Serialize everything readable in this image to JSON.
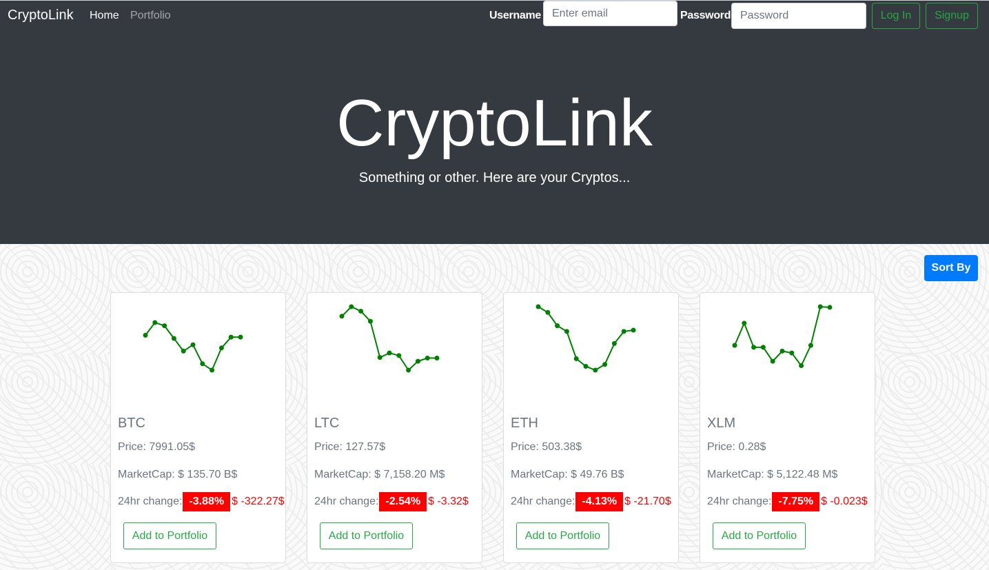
{
  "nav": {
    "brand": "CryptoLink",
    "links": [
      "Home",
      "Portfolio"
    ],
    "username_label": "Username",
    "email_placeholder": "Enter email",
    "password_label": "Password",
    "password_placeholder": "Password",
    "login_label": "Log In",
    "signup_label": "Signup"
  },
  "hero": {
    "title": "CryptoLink",
    "subtitle": "Something or other. Here are your Cryptos..."
  },
  "toolbar": {
    "sort_label": "Sort By"
  },
  "colors": {
    "dark": "#343a40",
    "success": "#28a745",
    "primary": "#007bff",
    "negative": "#ff0000",
    "spark": "#008000"
  },
  "cards": [
    {
      "symbol": "BTC",
      "price": "Price: 7991.05$",
      "market_cap": "MarketCap: $ 135.70 B$",
      "change_label": "24hr change:",
      "change_pct": "-3.88%",
      "change_abs": "$ -322.27$",
      "add_label": "Add to Portfolio",
      "spark": [
        0.55,
        0.75,
        0.7,
        0.5,
        0.3,
        0.4,
        0.1,
        0.0,
        0.35,
        0.52,
        0.52
      ]
    },
    {
      "symbol": "LTC",
      "price": "Price: 127.57$",
      "market_cap": "MarketCap: $ 7,158.20 M$",
      "change_label": "24hr change:",
      "change_pct": "-2.54%",
      "change_abs": "$ -3.32$",
      "add_label": "Add to Portfolio",
      "spark": [
        0.85,
        1.0,
        0.93,
        0.77,
        0.2,
        0.27,
        0.23,
        0.0,
        0.14,
        0.19,
        0.19
      ]
    },
    {
      "symbol": "ETH",
      "price": "Price: 503.38$",
      "market_cap": "MarketCap: $ 49.76 B$",
      "change_label": "24hr change:",
      "change_pct": "-4.13%",
      "change_abs": "$ -21.70$",
      "add_label": "Add to Portfolio",
      "spark": [
        1.0,
        0.91,
        0.7,
        0.61,
        0.18,
        0.06,
        0.0,
        0.09,
        0.42,
        0.61,
        0.63
      ]
    },
    {
      "symbol": "XLM",
      "price": "Price: 0.28$",
      "market_cap": "MarketCap: $ 5,122.48 M$",
      "change_label": "24hr change:",
      "change_pct": "-7.75%",
      "change_abs": "$ -0.023$",
      "add_label": "Add to Portfolio",
      "spark": [
        0.39,
        0.74,
        0.36,
        0.36,
        0.14,
        0.3,
        0.27,
        0.07,
        0.39,
        1.0,
        0.99
      ]
    }
  ]
}
